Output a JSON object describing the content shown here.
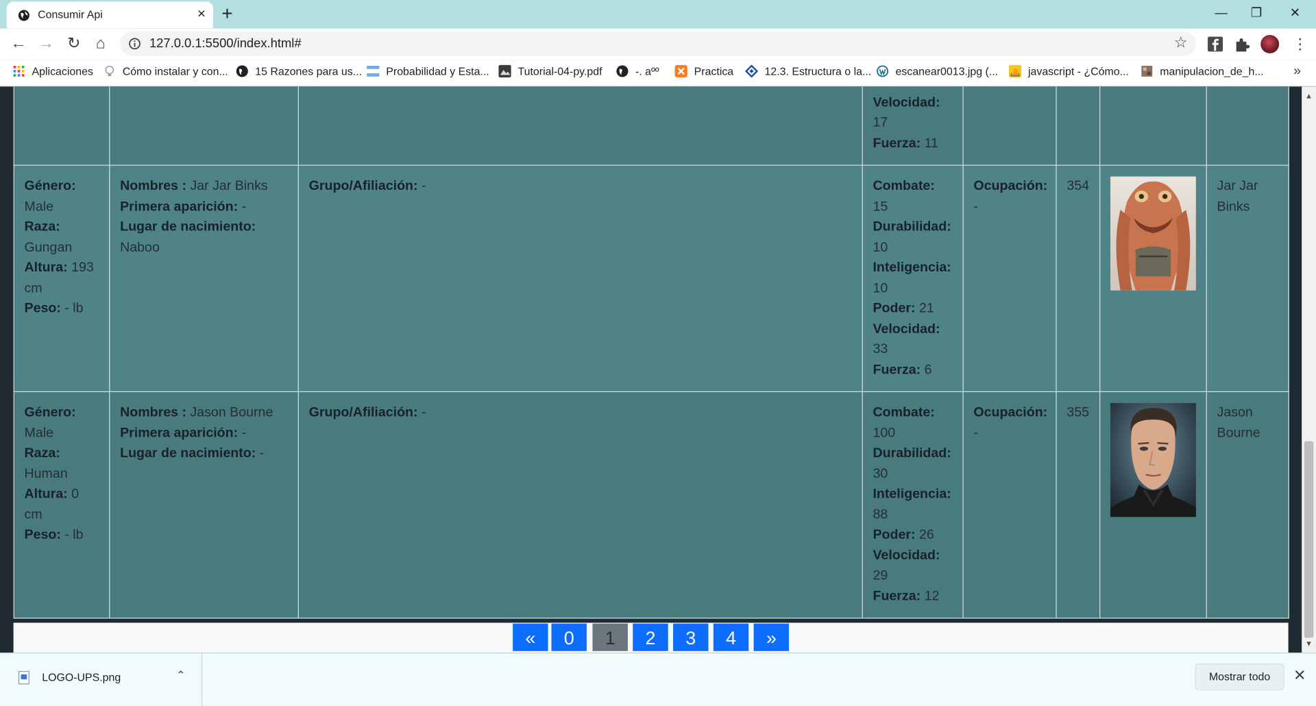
{
  "window": {
    "tab_title": "Consumir Api",
    "url": "127.0.0.1:5500/index.html#"
  },
  "bookmarks": [
    {
      "label": "Aplicaciones",
      "icon": "apps-grid-icon",
      "color": "#e8453c"
    },
    {
      "label": "Cómo instalar y con...",
      "icon": "lightbulb-icon",
      "color": "#9aa0a6"
    },
    {
      "label": "15 Razones para us...",
      "icon": "globe-icon",
      "color": "#202124"
    },
    {
      "label": "Probabilidad y Esta...",
      "icon": "flag-icon",
      "color": "#74acdf"
    },
    {
      "label": "Tutorial-04-py.pdf",
      "icon": "pdf-icon",
      "color": "#3a3a3a"
    },
    {
      "label": "-. aºº",
      "icon": "globe-icon",
      "color": "#202124"
    },
    {
      "label": "Practica",
      "icon": "xampp-icon",
      "color": "#fb7a24"
    },
    {
      "label": "12.3. Estructura o la...",
      "icon": "diamond-icon",
      "color": "#1d4e9a"
    },
    {
      "label": "escanear0013.jpg (...",
      "icon": "wordpress-icon",
      "color": "#21759b"
    },
    {
      "label": "javascript - ¿Cómo...",
      "icon": "stackoverflow-icon",
      "color": "#f48024"
    },
    {
      "label": "manipulacion_de_h...",
      "icon": "puzzle-icon",
      "color": "#8d6e63"
    }
  ],
  "table": {
    "top_partial": {
      "power_lines": [
        {
          "label": "Velocidad:",
          "value": "17"
        },
        {
          "label": "Fuerza:",
          "value": "11"
        }
      ]
    },
    "rows": [
      {
        "appearance": [
          {
            "label": "Género:",
            "value": "Male"
          },
          {
            "label": "Raza:",
            "value": "Gungan"
          },
          {
            "label": "Altura:",
            "value": "193 cm"
          },
          {
            "label": "Peso:",
            "value": "- lb"
          }
        ],
        "bio": [
          {
            "label": "Nombres :",
            "value": "Jar Jar Binks"
          },
          {
            "label": "Primera aparición:",
            "value": "-"
          },
          {
            "label": "Lugar de nacimiento:",
            "value": "Naboo"
          }
        ],
        "connections": {
          "label": "Grupo/Afiliación:",
          "value": "-"
        },
        "powerstats": [
          {
            "label": "Combate:",
            "value": "15"
          },
          {
            "label": "Durabilidad:",
            "value": "10"
          },
          {
            "label": "Inteligencia:",
            "value": "10"
          },
          {
            "label": "Poder:",
            "value": "21"
          },
          {
            "label": "Velocidad:",
            "value": "33"
          },
          {
            "label": "Fuerza:",
            "value": "6"
          }
        ],
        "work": {
          "label": "Ocupación:",
          "value": "-"
        },
        "id": "354",
        "name": "Jar Jar Binks"
      },
      {
        "appearance": [
          {
            "label": "Género:",
            "value": "Male"
          },
          {
            "label": "Raza:",
            "value": "Human"
          },
          {
            "label": "Altura:",
            "value": "0 cm"
          },
          {
            "label": "Peso:",
            "value": "- lb"
          }
        ],
        "bio": [
          {
            "label": "Nombres :",
            "value": "Jason Bourne"
          },
          {
            "label": "Primera aparición:",
            "value": "-"
          },
          {
            "label": "Lugar de nacimiento:",
            "value": "-"
          }
        ],
        "connections": {
          "label": "Grupo/Afiliación:",
          "value": "-"
        },
        "powerstats": [
          {
            "label": "Combate:",
            "value": "100"
          },
          {
            "label": "Durabilidad:",
            "value": "30"
          },
          {
            "label": "Inteligencia:",
            "value": "88"
          },
          {
            "label": "Poder:",
            "value": "26"
          },
          {
            "label": "Velocidad:",
            "value": "29"
          },
          {
            "label": "Fuerza:",
            "value": "12"
          }
        ],
        "work": {
          "label": "Ocupación:",
          "value": "-"
        },
        "id": "355",
        "name": "Jason Bourne"
      }
    ]
  },
  "pagination": [
    "«",
    "0",
    "1",
    "2",
    "3",
    "4",
    "»"
  ],
  "pagination_active": "1",
  "download_shelf": {
    "filename": "LOGO-UPS.png",
    "show_all": "Mostrar todo"
  },
  "colors": {
    "tab_strip": "#b4dfe0",
    "table_row": "#497a7e",
    "page_bg": "#1f2a33",
    "pagination_blue": "#0d6efd",
    "pagination_active": "#6c757d"
  }
}
